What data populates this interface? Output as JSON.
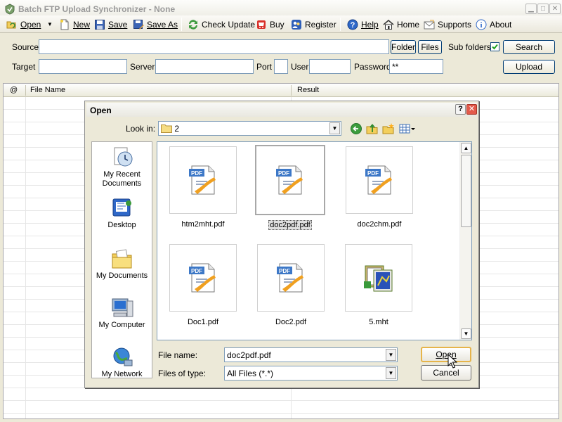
{
  "window": {
    "title": "Batch FTP Upload Synchronizer - None"
  },
  "toolbar": {
    "open": "Open",
    "new": "New",
    "save": "Save",
    "save_as": "Save As",
    "check_update": "Check Update",
    "buy": "Buy",
    "register": "Register",
    "help": "Help",
    "home": "Home",
    "supports": "Supports",
    "about": "About"
  },
  "form": {
    "source_label": "Source",
    "source_value": "",
    "folder_btn": "Folder",
    "files_btn": "Files",
    "subfolders_label": "Sub folders",
    "subfolders_checked": true,
    "search_btn": "Search",
    "target_label": "Target",
    "target_value": "",
    "server_label": "Server",
    "server_value": "",
    "port_label": "Port",
    "port_value": "",
    "user_label": "User",
    "user_value": "",
    "password_label": "Password",
    "password_value": "**",
    "upload_btn": "Upload"
  },
  "grid": {
    "col_at": "@",
    "col_file": "File Name",
    "col_result": "Result"
  },
  "dialog": {
    "title": "Open",
    "look_in_label": "Look in:",
    "look_in_value": "2",
    "places": [
      {
        "label": "My Recent Documents",
        "icon": "recent-documents-icon"
      },
      {
        "label": "Desktop",
        "icon": "desktop-icon"
      },
      {
        "label": "My Documents",
        "icon": "my-documents-icon"
      },
      {
        "label": "My Computer",
        "icon": "my-computer-icon"
      },
      {
        "label": "My Network",
        "icon": "my-network-icon"
      }
    ],
    "files": [
      {
        "name": "htm2mht.pdf",
        "icon": "pdf-file-icon",
        "selected": false
      },
      {
        "name": "doc2pdf.pdf",
        "icon": "pdf-file-icon",
        "selected": true
      },
      {
        "name": "doc2chm.pdf",
        "icon": "pdf-file-icon",
        "selected": false
      },
      {
        "name": "Doc1.pdf",
        "icon": "pdf-file-icon",
        "selected": false
      },
      {
        "name": "Doc2.pdf",
        "icon": "pdf-file-icon",
        "selected": false
      },
      {
        "name": "5.mht",
        "icon": "mht-file-icon",
        "selected": false
      }
    ],
    "file_name_label": "File name:",
    "file_name_value": "doc2pdf.pdf",
    "file_type_label": "Files of type:",
    "file_type_value": "All Files (*.*)",
    "open_btn": "Open",
    "cancel_btn": "Cancel"
  }
}
